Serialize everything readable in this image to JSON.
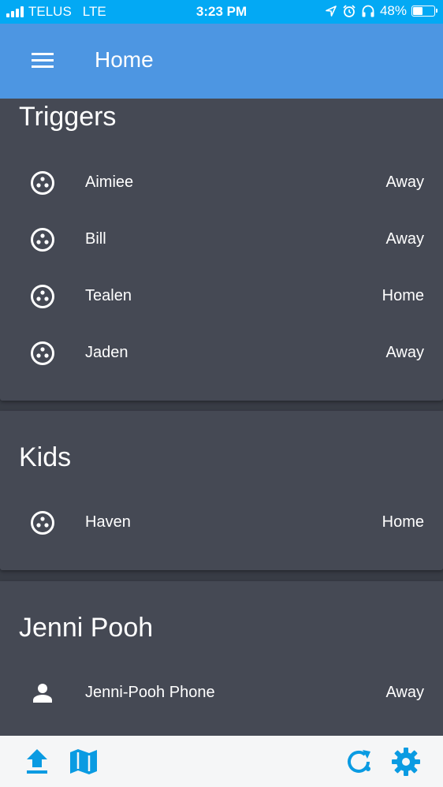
{
  "status_bar": {
    "carrier": "TELUS",
    "network": "LTE",
    "time": "3:23 PM",
    "battery_percent": "48%",
    "battery_level": 0.48,
    "icons": [
      "location-icon",
      "alarm-icon",
      "headphones-icon",
      "battery-icon"
    ]
  },
  "header": {
    "title": "Home",
    "menu_icon": "menu-icon"
  },
  "colors": {
    "status_bar": "#03a9f4",
    "header": "#4d96e2",
    "card": "#454954",
    "background": "#383c45",
    "bottom_icons": "#0a9be2"
  },
  "cards": [
    {
      "title": "Triggers",
      "rows": [
        {
          "label": "Aimiee",
          "state": "Away",
          "icon": "tracker-icon"
        },
        {
          "label": "Bill",
          "state": "Away",
          "icon": "tracker-icon"
        },
        {
          "label": "Tealen",
          "state": "Home",
          "icon": "tracker-icon"
        },
        {
          "label": "Jaden",
          "state": "Away",
          "icon": "tracker-icon"
        }
      ]
    },
    {
      "title": "Kids",
      "rows": [
        {
          "label": "Haven",
          "state": "Home",
          "icon": "tracker-icon"
        }
      ]
    },
    {
      "title": "Jenni Pooh",
      "rows": [
        {
          "label": "Jenni-Pooh Phone",
          "state": "Away",
          "icon": "person-icon"
        }
      ]
    }
  ],
  "bottom_bar": {
    "icons": [
      "upload-icon",
      "map-icon",
      "refresh-icon",
      "settings-icon"
    ]
  }
}
